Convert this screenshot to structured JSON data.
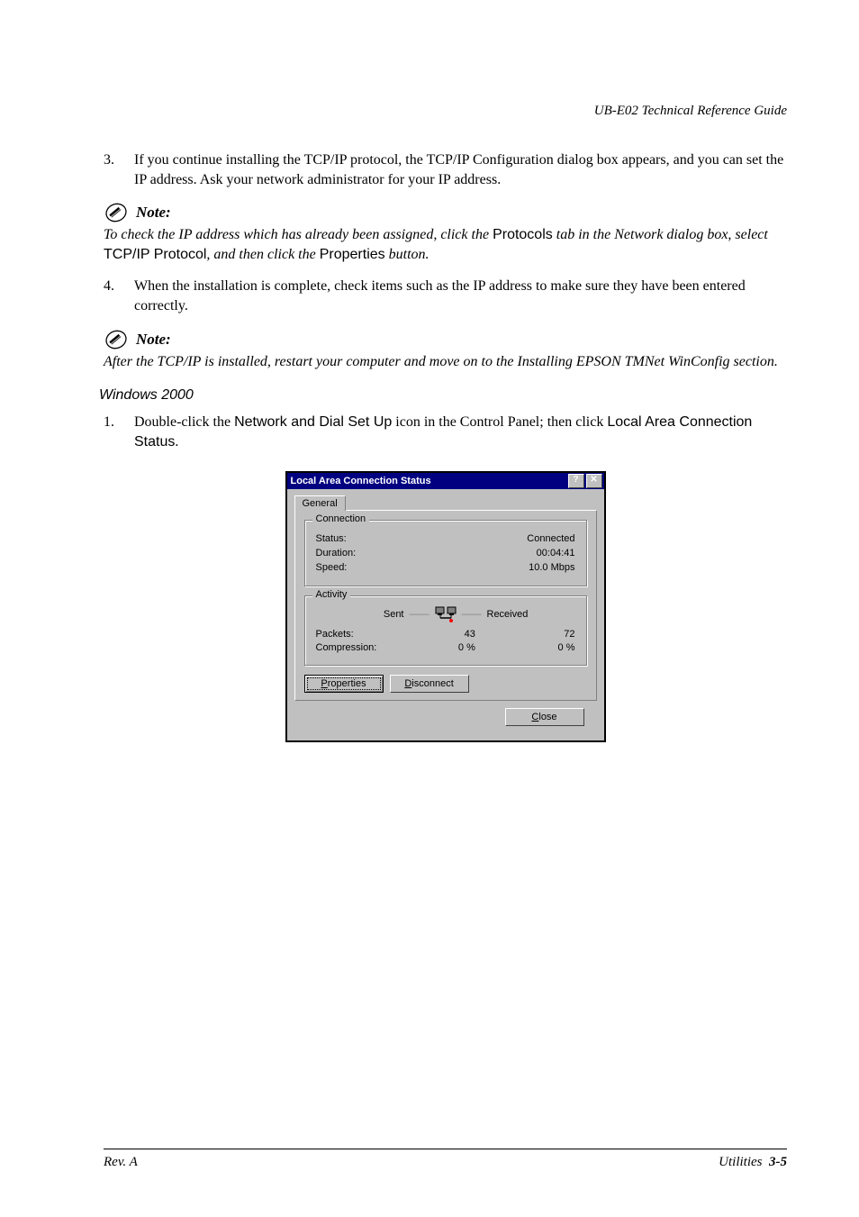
{
  "header": {
    "doc_title": "UB-E02 Technical Reference Guide"
  },
  "list": {
    "item3": {
      "num": "3.",
      "text": "If you continue installing the TCP/IP protocol, the TCP/IP Configuration dialog box appears, and you can set the IP address. Ask your network administrator for your IP address."
    },
    "item4": {
      "num": "4.",
      "text": "When the installation is complete, check items such as the IP address to make sure they have been entered correctly."
    },
    "item1b": {
      "num": "1.",
      "pre": "Double-click the ",
      "sans1": "Network and Dial Set Up",
      "mid": " icon in the Control Panel; then click ",
      "sans2": "Local Area Connection Status",
      "post": "."
    }
  },
  "notes": {
    "label": "Note:",
    "note1": {
      "pre": "To check the IP address which has already been assigned, click the ",
      "s1": "Protocols",
      "mid1": " tab in the Network dialog box, select ",
      "s2": "TCP/IP Protocol",
      "mid2": ", and then click the ",
      "s3": "Properties",
      "post": " button."
    },
    "note2": "After the TCP/IP is installed, restart your computer and move on to the Installing EPSON TMNet WinConfig section."
  },
  "section": {
    "heading": "Windows 2000"
  },
  "dialog": {
    "title": "Local Area Connection Status",
    "help_glyph": "?",
    "close_glyph": "✕",
    "tab": "General",
    "group_connection": {
      "legend": "Connection",
      "status_label": "Status:",
      "status_value": "Connected",
      "duration_label": "Duration:",
      "duration_value": "00:04:41",
      "speed_label": "Speed:",
      "speed_value": "10.0 Mbps"
    },
    "group_activity": {
      "legend": "Activity",
      "sent": "Sent",
      "received": "Received",
      "packets_label": "Packets:",
      "packets_sent": "43",
      "packets_recv": "72",
      "compression_label": "Compression:",
      "comp_sent": "0 %",
      "comp_recv": "0 %"
    },
    "buttons": {
      "properties": "Properties",
      "disconnect": "Disconnect",
      "close": "Close"
    }
  },
  "footer": {
    "left": "Rev. A",
    "right_label": "Utilities",
    "page": "3-5"
  }
}
